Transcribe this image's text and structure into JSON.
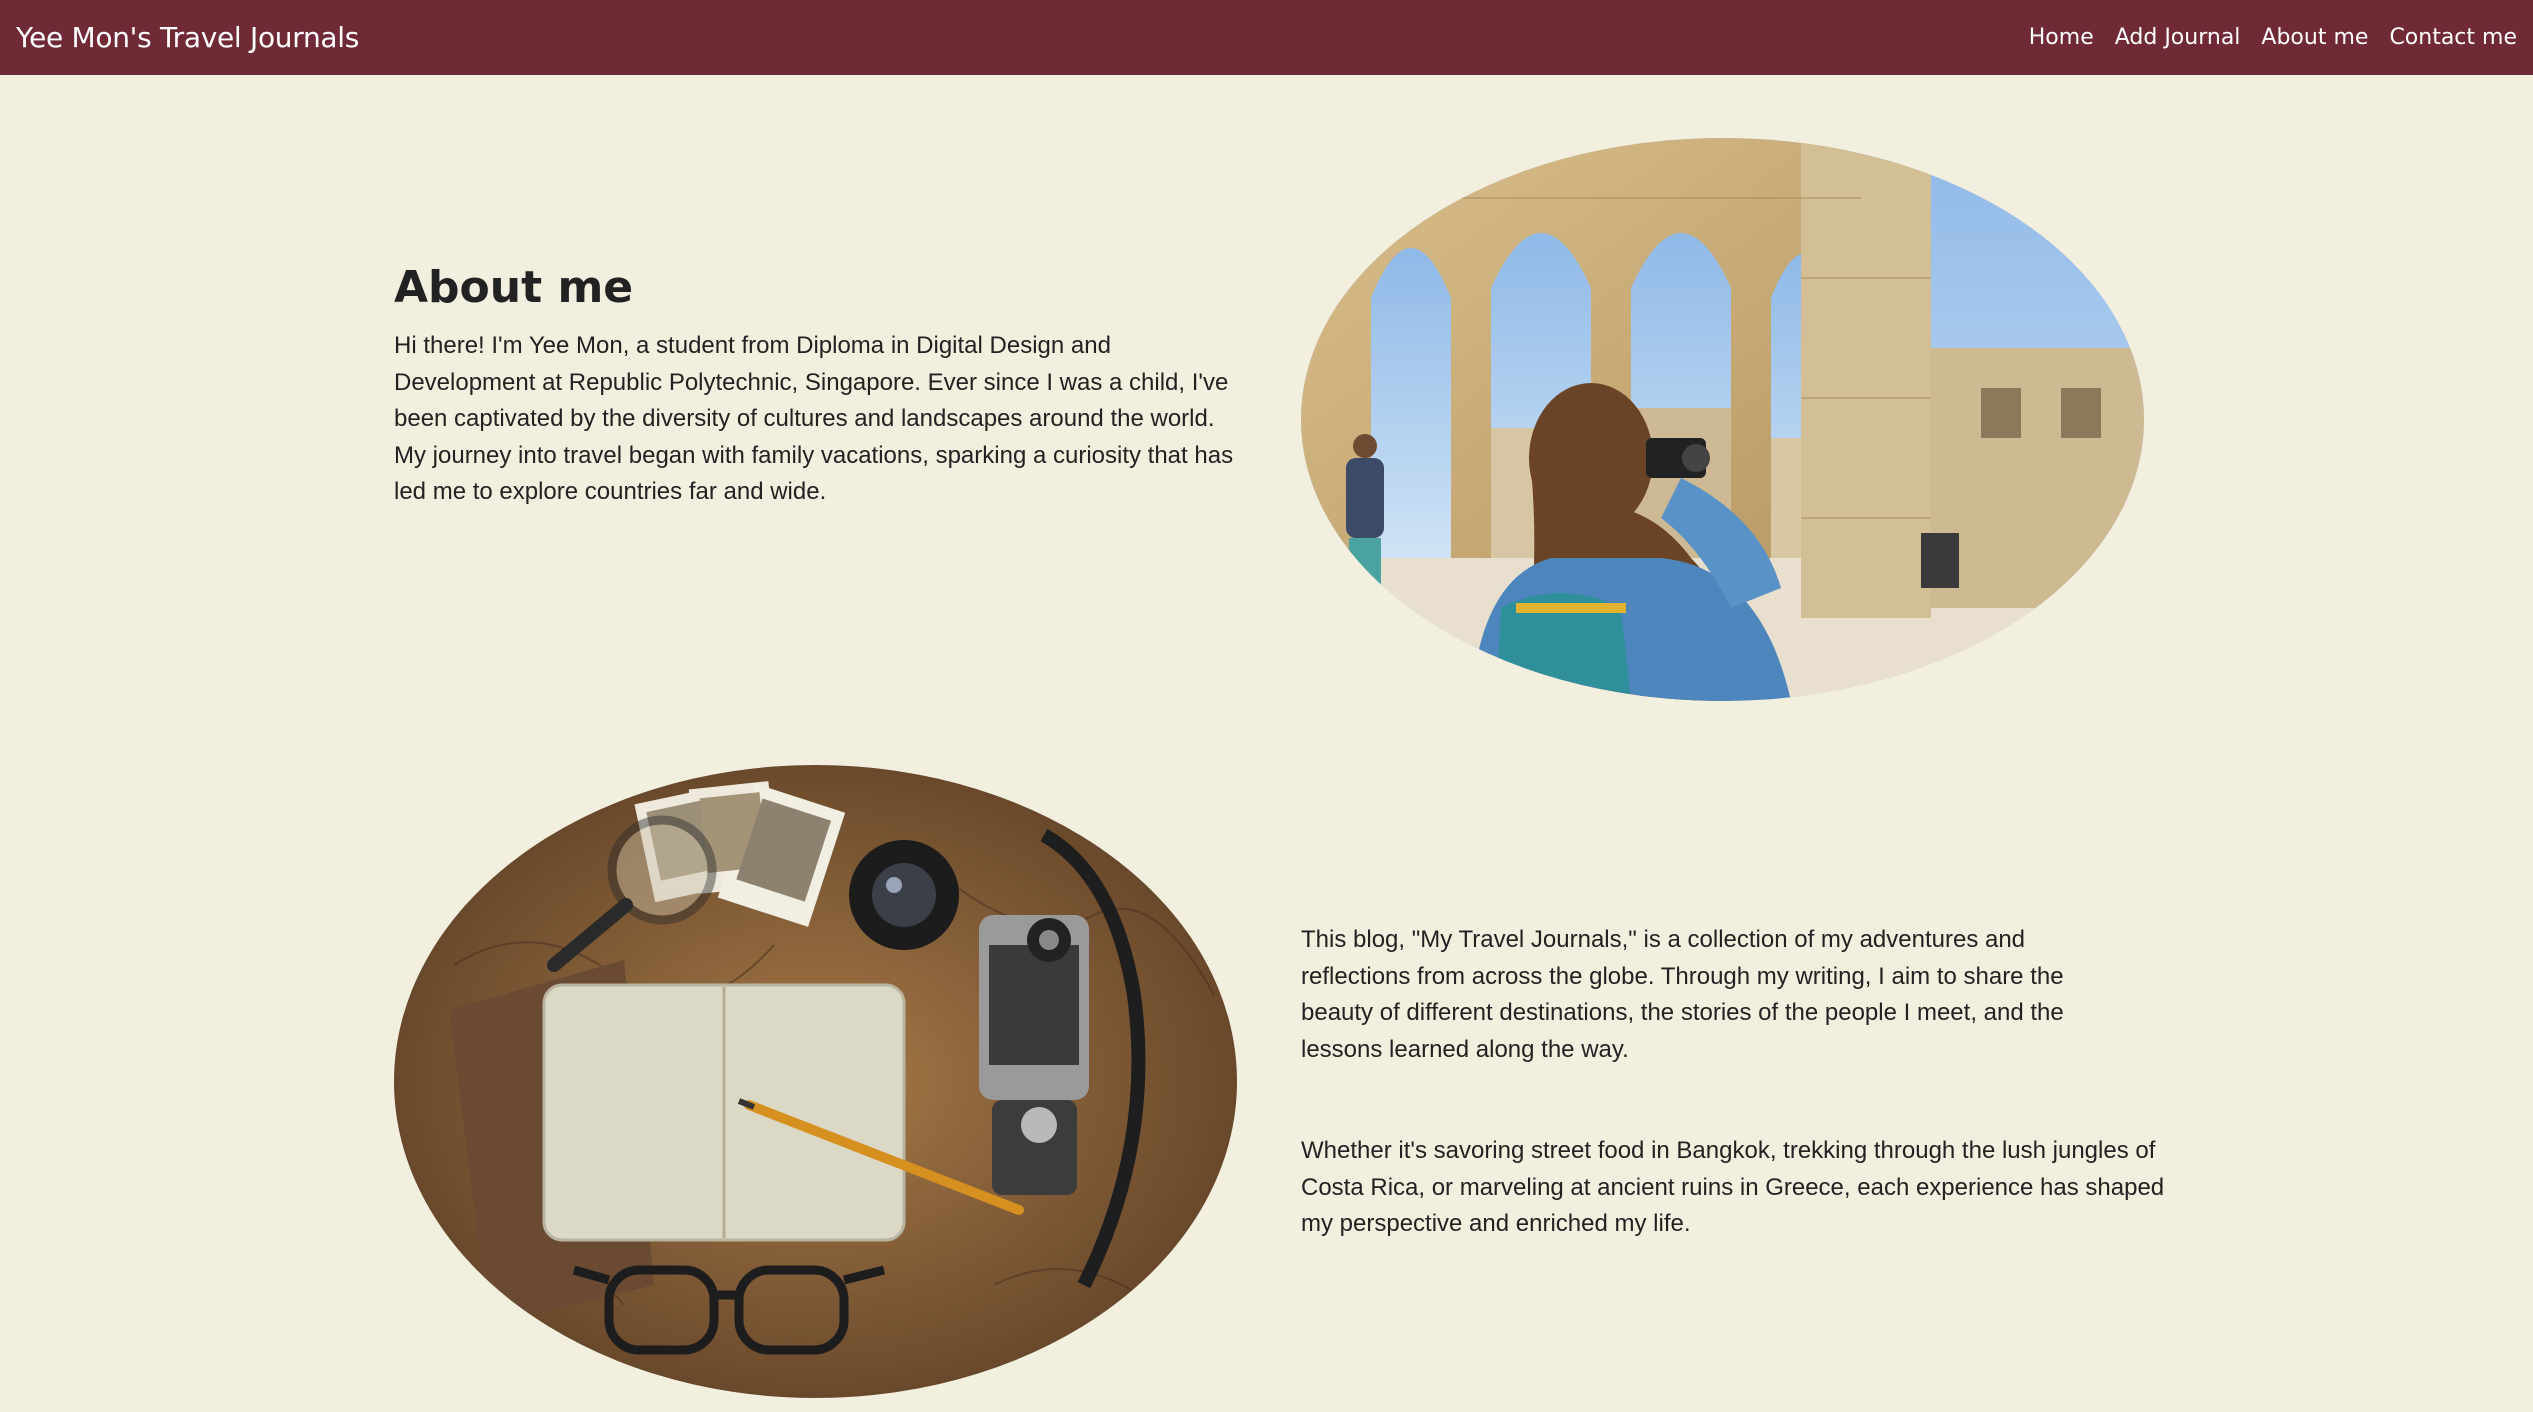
{
  "nav": {
    "brand": "Yee Mon's Travel Journals",
    "links": [
      "Home",
      "Add Journal",
      "About me",
      "Contact me"
    ]
  },
  "about": {
    "heading": "About me",
    "intro": "Hi there! I'm Yee Mon, a student from Diploma in Digital Design and Development at Republic Polytechnic, Singapore. Ever since I was a child, I've been captivated by the diversity of cultures and landscapes around the world. My journey into travel began with family vacations, sparking a curiosity that has led me to explore countries far and wide.",
    "blog_description": "This blog, \"My Travel Journals,\" is a collection of my adventures and reflections from across the globe. Through my writing, I aim to share the beauty of different destinations, the stories of the people I meet, and the lessons learned along the way.",
    "experiences": "Whether it's savoring street food in Bangkok, trekking through the lush jungles of Costa Rica, or marveling at ancient ruins in Greece, each experience has shaped my perspective and enriched my life."
  },
  "colors": {
    "navbar": "#702a36",
    "background": "#f2efdf",
    "text": "#222222"
  }
}
